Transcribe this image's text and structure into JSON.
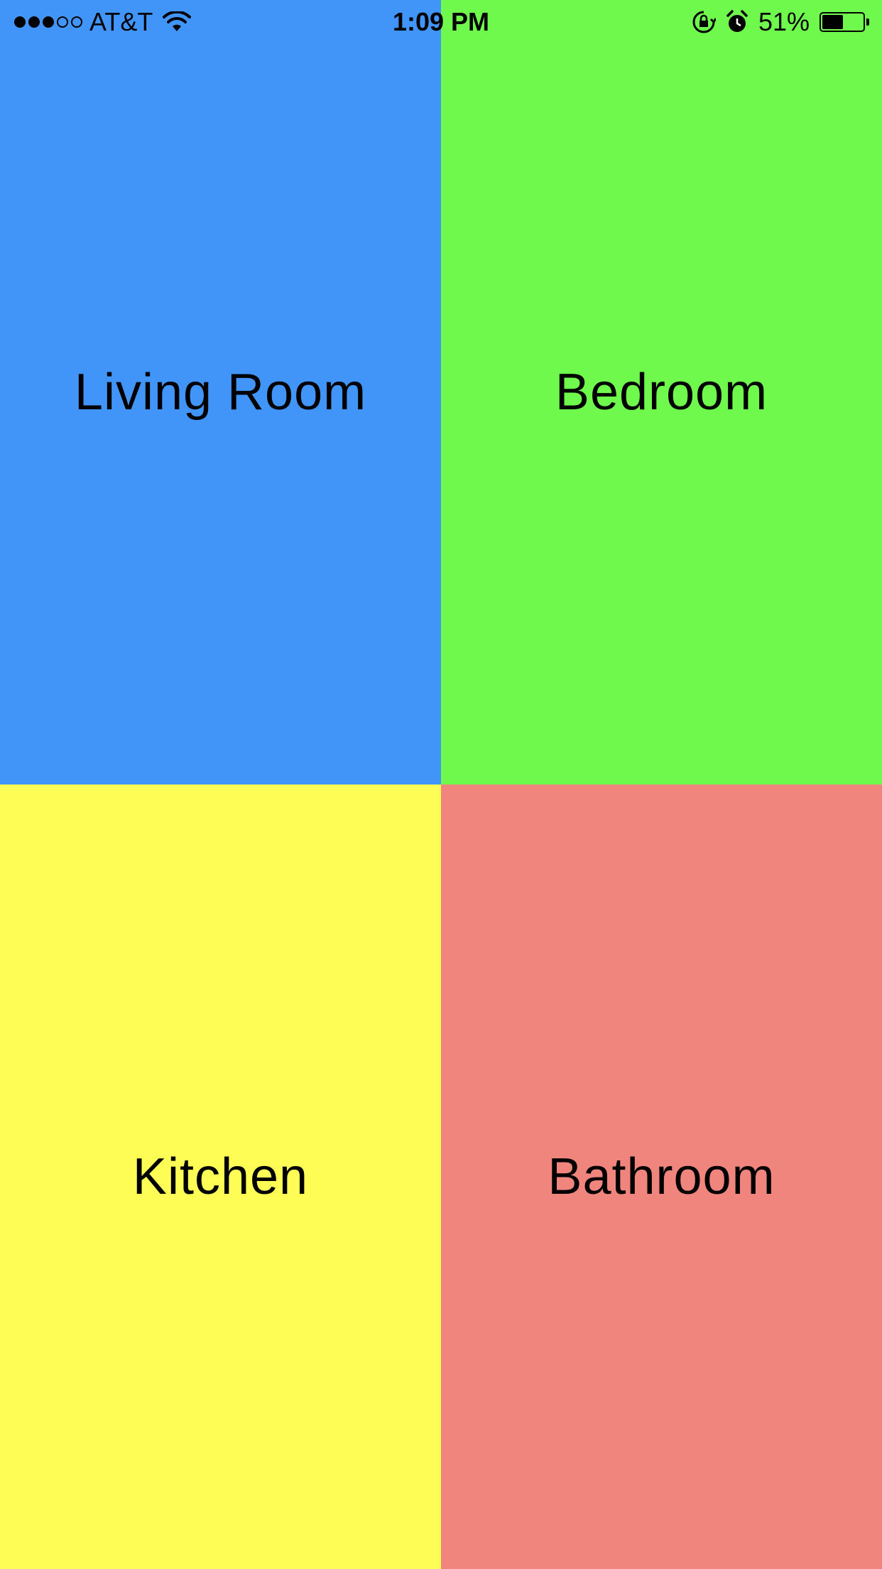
{
  "status_bar": {
    "signal_bars_filled": 3,
    "signal_bars_total": 5,
    "carrier": "AT&T",
    "wifi_icon": "wifi-icon",
    "time": "1:09 PM",
    "rotation_lock_icon": "rotation-lock-icon",
    "alarm_icon": "alarm-icon",
    "battery_percent": "51%",
    "battery_level": 0.51
  },
  "rooms": [
    {
      "label": "Living Room",
      "color": "#4295F8"
    },
    {
      "label": "Bedroom",
      "color": "#6FF94C"
    },
    {
      "label": "Kitchen",
      "color": "#FEFD56"
    },
    {
      "label": "Bathroom",
      "color": "#EF857D"
    }
  ]
}
